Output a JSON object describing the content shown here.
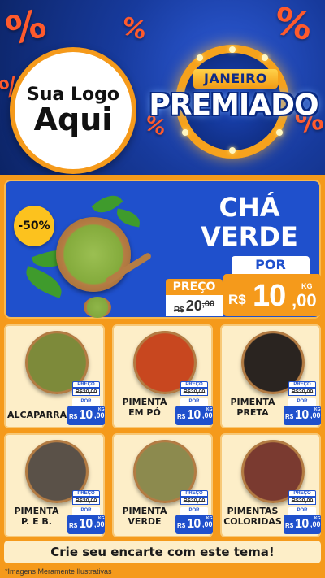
{
  "hero": {
    "percent_symbol": "%",
    "logo_line1": "Sua Logo",
    "logo_line2": "Aqui",
    "badge_top": "JANEIRO",
    "badge_main": "PREMIADO"
  },
  "featured": {
    "discount": "-50%",
    "title_line1": "CHÁ",
    "title_line2": "VERDE",
    "preco_label": "PREÇO",
    "old_currency": "R$",
    "old_int": "20",
    "old_dec": ",00",
    "por_label": "POR",
    "currency": "R$",
    "price_int": "10",
    "price_dec": ",00",
    "unit": "KG"
  },
  "products": [
    {
      "name1": "ALCAPARRAS",
      "name2": "",
      "preco_label": "PREÇO",
      "old": "R$20,00",
      "por_label": "POR",
      "currency": "R$",
      "price_int": "10",
      "price_dec": ",00",
      "unit": "KG",
      "bowl_color": "#7d8a3a"
    },
    {
      "name1": "PIMENTA",
      "name2": "EM PÓ",
      "preco_label": "PREÇO",
      "old": "R$20,00",
      "por_label": "POR",
      "currency": "R$",
      "price_int": "10",
      "price_dec": ",00",
      "unit": "KG",
      "bowl_color": "#c8471f"
    },
    {
      "name1": "PIMENTA",
      "name2": "PRETA",
      "preco_label": "PREÇO",
      "old": "R$20,00",
      "por_label": "POR",
      "currency": "R$",
      "price_int": "10",
      "price_dec": ",00",
      "unit": "KG",
      "bowl_color": "#2a2420"
    },
    {
      "name1": "PIMENTA",
      "name2": "P. E B.",
      "preco_label": "PREÇO",
      "old": "R$20,00",
      "por_label": "POR",
      "currency": "R$",
      "price_int": "10",
      "price_dec": ",00",
      "unit": "KG",
      "bowl_color": "#5a5148"
    },
    {
      "name1": "PIMENTA",
      "name2": "VERDE",
      "preco_label": "PREÇO",
      "old": "R$20,00",
      "por_label": "POR",
      "currency": "R$",
      "price_int": "10",
      "price_dec": ",00",
      "unit": "KG",
      "bowl_color": "#8c8a4e"
    },
    {
      "name1": "PIMENTAS",
      "name2": "COLORIDAS",
      "preco_label": "PREÇO",
      "old": "R$20,00",
      "por_label": "POR",
      "currency": "R$",
      "price_int": "10",
      "price_dec": ",00",
      "unit": "KG",
      "bowl_color": "#7a3a30"
    }
  ],
  "banner": "Crie seu encarte com este tema!",
  "note": "*Imagens Meramente Ilustrativas",
  "colors": {
    "blue": "#1f50cc",
    "orange": "#f59a1b",
    "cream": "#fdeec8",
    "percent": "#ff5a2c"
  }
}
